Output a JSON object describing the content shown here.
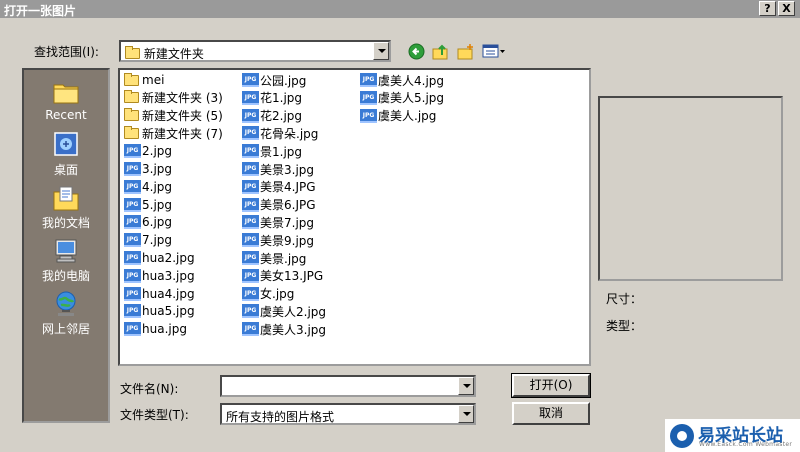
{
  "window": {
    "title": "打开一张图片",
    "help_btn": "?",
    "close_btn": "X"
  },
  "lookin": {
    "label": "查找范围(I):",
    "value": "新建文件夹"
  },
  "toolbar": {
    "back_icon": "green-back-arrow-icon",
    "up_icon": "up-folder-icon",
    "newfolder_icon": "new-folder-icon",
    "view_icon": "view-menu-icon"
  },
  "places": [
    {
      "label": "Recent",
      "icon": "recent-folder-icon"
    },
    {
      "label": "桌面",
      "icon": "desktop-icon"
    },
    {
      "label": "我的文档",
      "icon": "my-documents-icon"
    },
    {
      "label": "我的电脑",
      "icon": "my-computer-icon"
    },
    {
      "label": "网上邻居",
      "icon": "network-icon"
    }
  ],
  "files": {
    "col1": [
      {
        "name": "mei",
        "type": "folder"
      },
      {
        "name": "新建文件夹 (3)",
        "type": "folder"
      },
      {
        "name": "新建文件夹 (5)",
        "type": "folder"
      },
      {
        "name": "新建文件夹 (7)",
        "type": "folder"
      },
      {
        "name": "2.jpg",
        "type": "jpg"
      },
      {
        "name": "3.jpg",
        "type": "jpg"
      },
      {
        "name": "4.jpg",
        "type": "jpg"
      },
      {
        "name": "5.jpg",
        "type": "jpg"
      },
      {
        "name": "6.jpg",
        "type": "jpg"
      },
      {
        "name": "7.jpg",
        "type": "jpg"
      },
      {
        "name": "hua2.jpg",
        "type": "jpg"
      },
      {
        "name": "hua3.jpg",
        "type": "jpg"
      },
      {
        "name": "hua4.jpg",
        "type": "jpg"
      },
      {
        "name": "hua5.jpg",
        "type": "jpg"
      },
      {
        "name": "hua.jpg",
        "type": "jpg"
      }
    ],
    "col2": [
      {
        "name": "公园.jpg",
        "type": "jpg"
      },
      {
        "name": "花1.jpg",
        "type": "jpg"
      },
      {
        "name": "花2.jpg",
        "type": "jpg"
      },
      {
        "name": "花骨朵.jpg",
        "type": "jpg"
      },
      {
        "name": "景1.jpg",
        "type": "jpg"
      },
      {
        "name": "美景3.jpg",
        "type": "jpg"
      },
      {
        "name": "美景4.JPG",
        "type": "jpg"
      },
      {
        "name": "美景6.JPG",
        "type": "jpg"
      },
      {
        "name": "美景7.jpg",
        "type": "jpg"
      },
      {
        "name": "美景9.jpg",
        "type": "jpg"
      },
      {
        "name": "美景.jpg",
        "type": "jpg"
      },
      {
        "name": "美女13.JPG",
        "type": "jpg"
      },
      {
        "name": "女.jpg",
        "type": "jpg"
      },
      {
        "name": "虞美人2.jpg",
        "type": "jpg"
      },
      {
        "name": "虞美人3.jpg",
        "type": "jpg"
      }
    ],
    "col3": [
      {
        "name": "虞美人4.jpg",
        "type": "jpg"
      },
      {
        "name": "虞美人5.jpg",
        "type": "jpg"
      },
      {
        "name": "虞美人.jpg",
        "type": "jpg"
      }
    ]
  },
  "jpg_badge": "JPG",
  "preview": {
    "size_label": "尺寸：",
    "type_label": "类型："
  },
  "filename": {
    "label": "文件名(N):",
    "value": ""
  },
  "filetype": {
    "label": "文件类型(T):",
    "value": "所有支持的图片格式"
  },
  "buttons": {
    "open": "打开(O)",
    "cancel": "取消"
  },
  "watermark": {
    "text": "易采站长站",
    "sub": "Www.Easck.Com Webmaster"
  }
}
